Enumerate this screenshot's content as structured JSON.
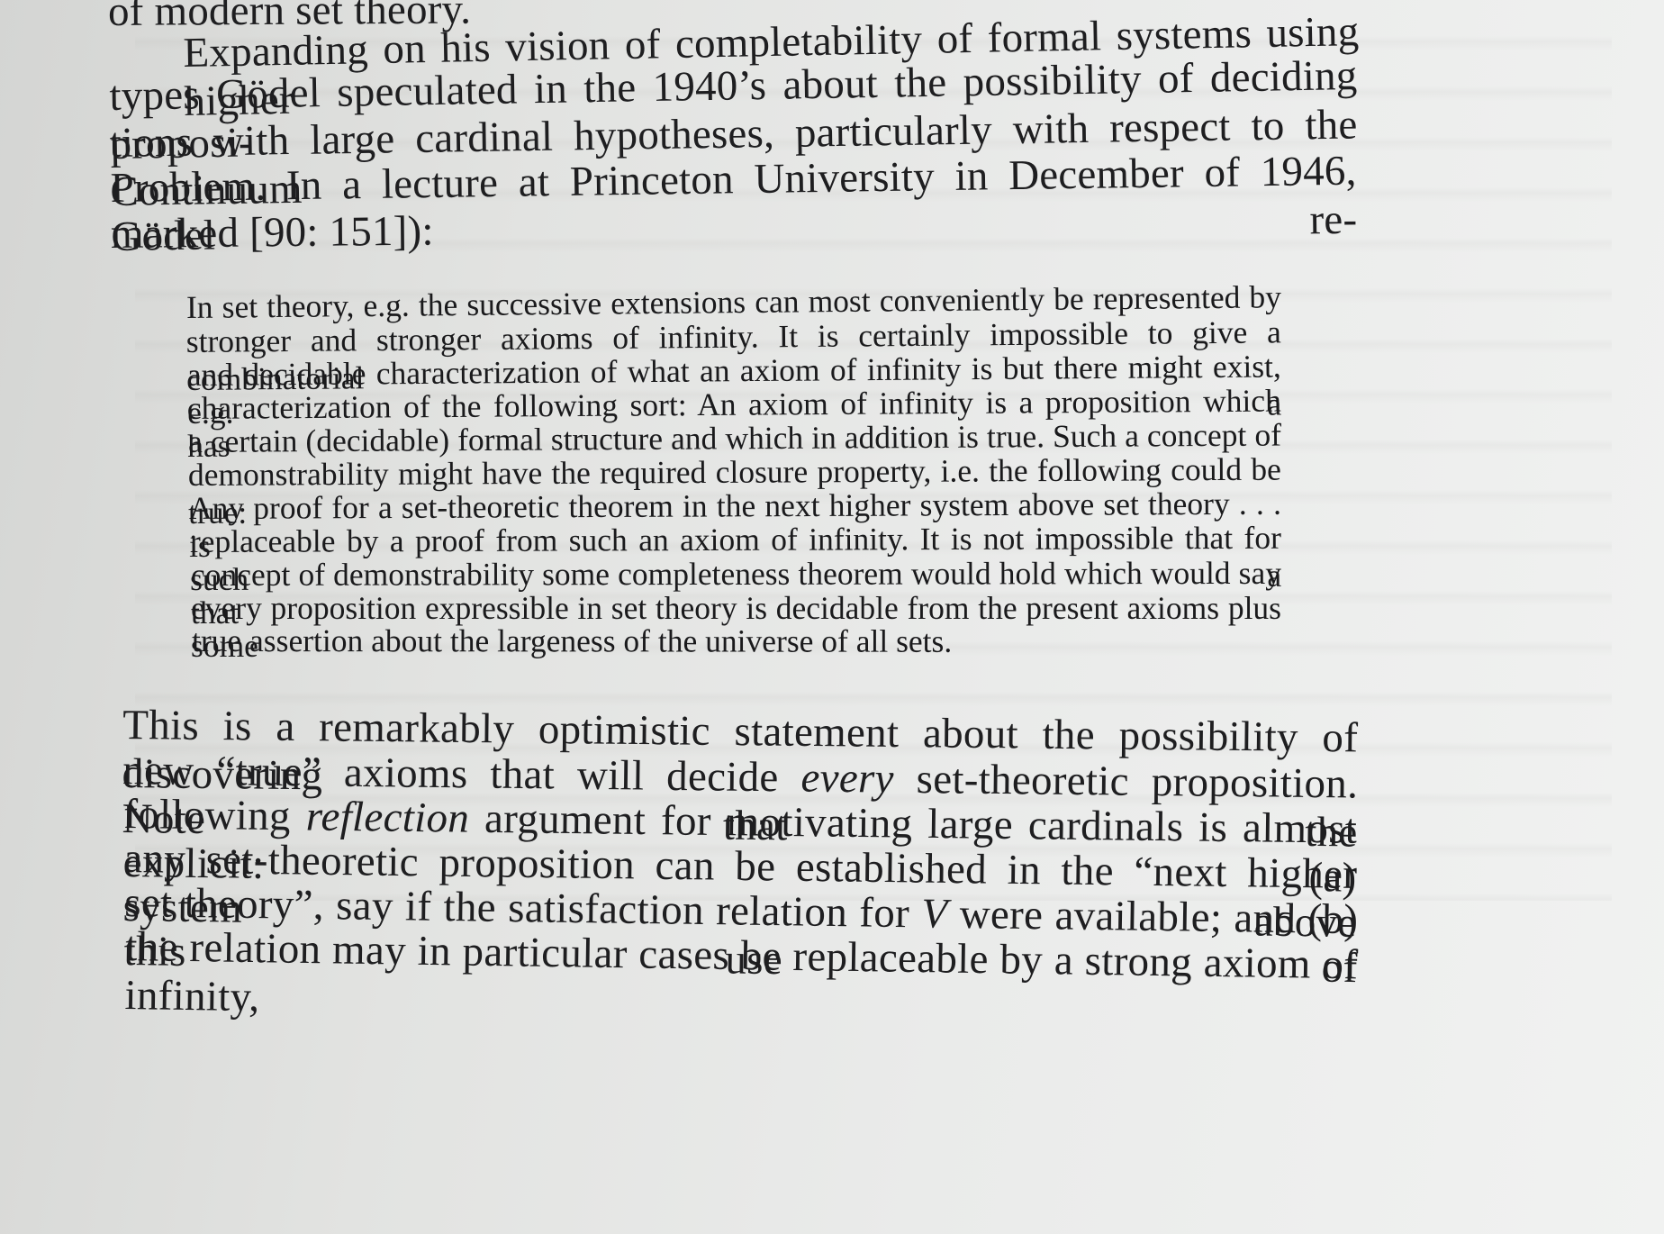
{
  "paragraphs": {
    "top_fragment": "of modern set theory.",
    "intro": [
      "Expanding on his vision of completability of formal systems using higher",
      "types Gödel speculated in the 1940’s about the possibility of deciding proposi-",
      "tions with large cardinal hypotheses, particularly with respect to the Continuum",
      "Problem.  In a lecture at Princeton University in December of 1946, Gödel re-",
      "marked [90: 151]):"
    ],
    "quote": [
      "In set theory, e.g. the successive extensions can most conveniently be represented by",
      "stronger and stronger axioms of infinity. It is certainly impossible to give a combinatorial",
      "and decidable characterization of what an axiom of infinity is but there might exist, e.g. a",
      "characterization of the following sort:  An axiom of infinity is a proposition which has",
      "a certain (decidable) formal structure and which in addition is true.  Such a concept of",
      "demonstrability might have the required closure property, i.e. the following could be true:",
      "Any proof for a set-theoretic theorem in the next higher system above set theory . . . is",
      "replaceable by a proof from such an axiom of infinity. It is not impossible that for such a",
      "concept of demonstrability some completeness theorem would hold which would say that",
      "every proposition expressible in set theory is decidable from the present axioms plus some",
      "true assertion about the largeness of the universe of all sets."
    ],
    "after": {
      "line1": "This is a remarkably optimistic statement about the possibility of discovering",
      "line2_a": "new “true” axioms that will decide ",
      "line2_em": "every",
      "line2_b": " set-theoretic proposition.  Note that the",
      "line3_a": "following ",
      "line3_em": "reflection",
      "line3_b": " argument for motivating large cardinals is almost explicit:  (a)",
      "line4": "any set-theoretic proposition can be established in the “next higher system above",
      "line5_a": "set theory”, say if the satisfaction relation for ",
      "line5_em": "V",
      "line5_b": " were available; and (b) this use of",
      "line6": "the relation may in particular cases be replaceable by a strong axiom of infinity,"
    }
  }
}
